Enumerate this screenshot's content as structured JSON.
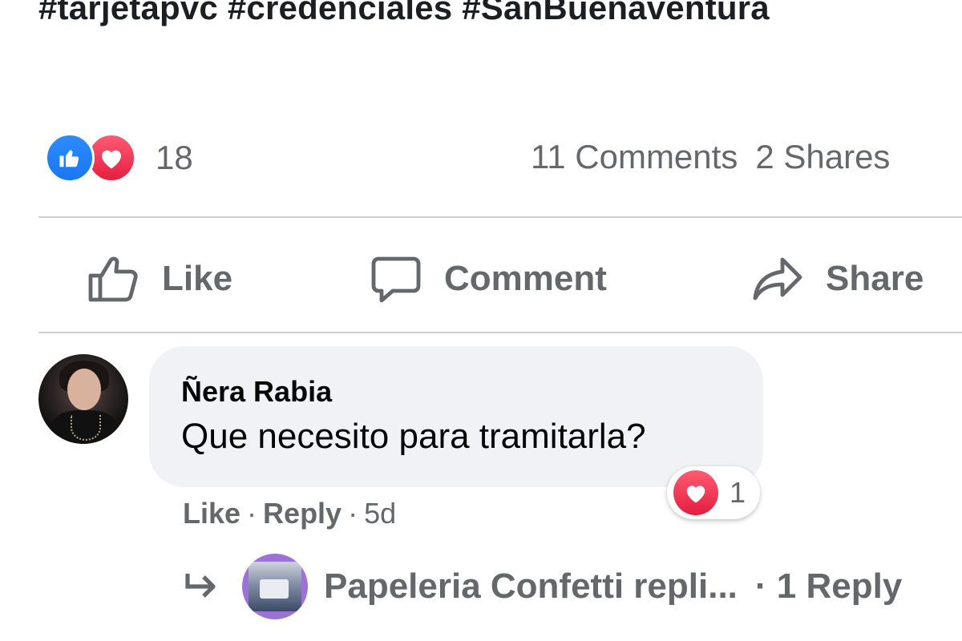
{
  "post": {
    "hashtags": "#tarjetapvc #credenciales #SanBuenaventura"
  },
  "reactions": {
    "icons": [
      "like-icon",
      "love-icon"
    ],
    "count": "18",
    "comments": "11 Comments",
    "shares": "2 Shares"
  },
  "actions": {
    "like": "Like",
    "comment": "Comment",
    "share": "Share"
  },
  "comment": {
    "author": "Ñera Rabia",
    "text": "Que necesito para tramitarla?",
    "reaction_count": "1",
    "like_label": "Like",
    "reply_label": "Reply",
    "time": "5d",
    "sep": "·"
  },
  "reply_thread": {
    "text": "Papeleria Confetti repli...",
    "count": "· 1 Reply"
  },
  "colors": {
    "like_blue": "#1877f2",
    "love_red": "#e41e3f",
    "secondary_text": "#65676b",
    "bubble_bg": "#f0f2f5"
  }
}
